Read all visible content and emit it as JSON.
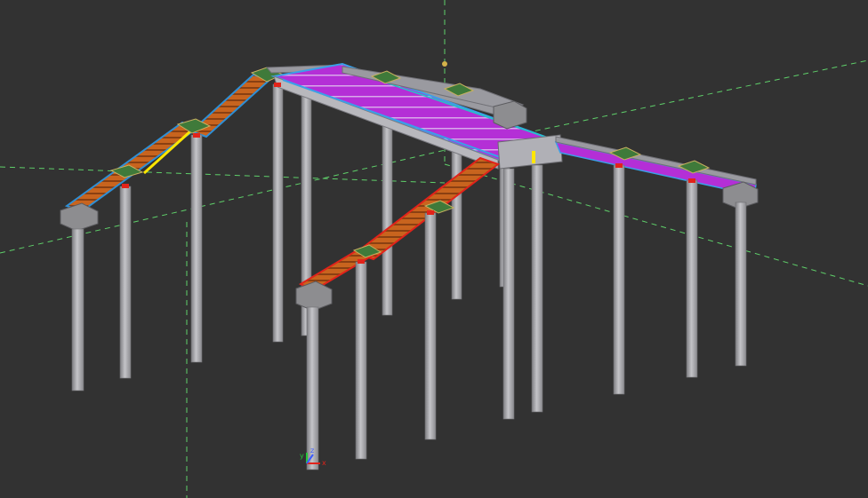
{
  "viewport": {
    "background": "#323232",
    "gridline_color": "#5fd06a",
    "column_color": "#a9a9ad",
    "stair_tread_color": "#c8641e",
    "deck_color": "#b42fd6",
    "rail_color": "#3aa0e8",
    "highlight_color": "#ffe600",
    "accent_red": "#e2231a"
  },
  "axis_triad": {
    "x_label": "x",
    "y_label": "y",
    "z_label": "z",
    "x_color": "#e2231a",
    "y_color": "#26c63a",
    "z_color": "#3b5bff"
  }
}
